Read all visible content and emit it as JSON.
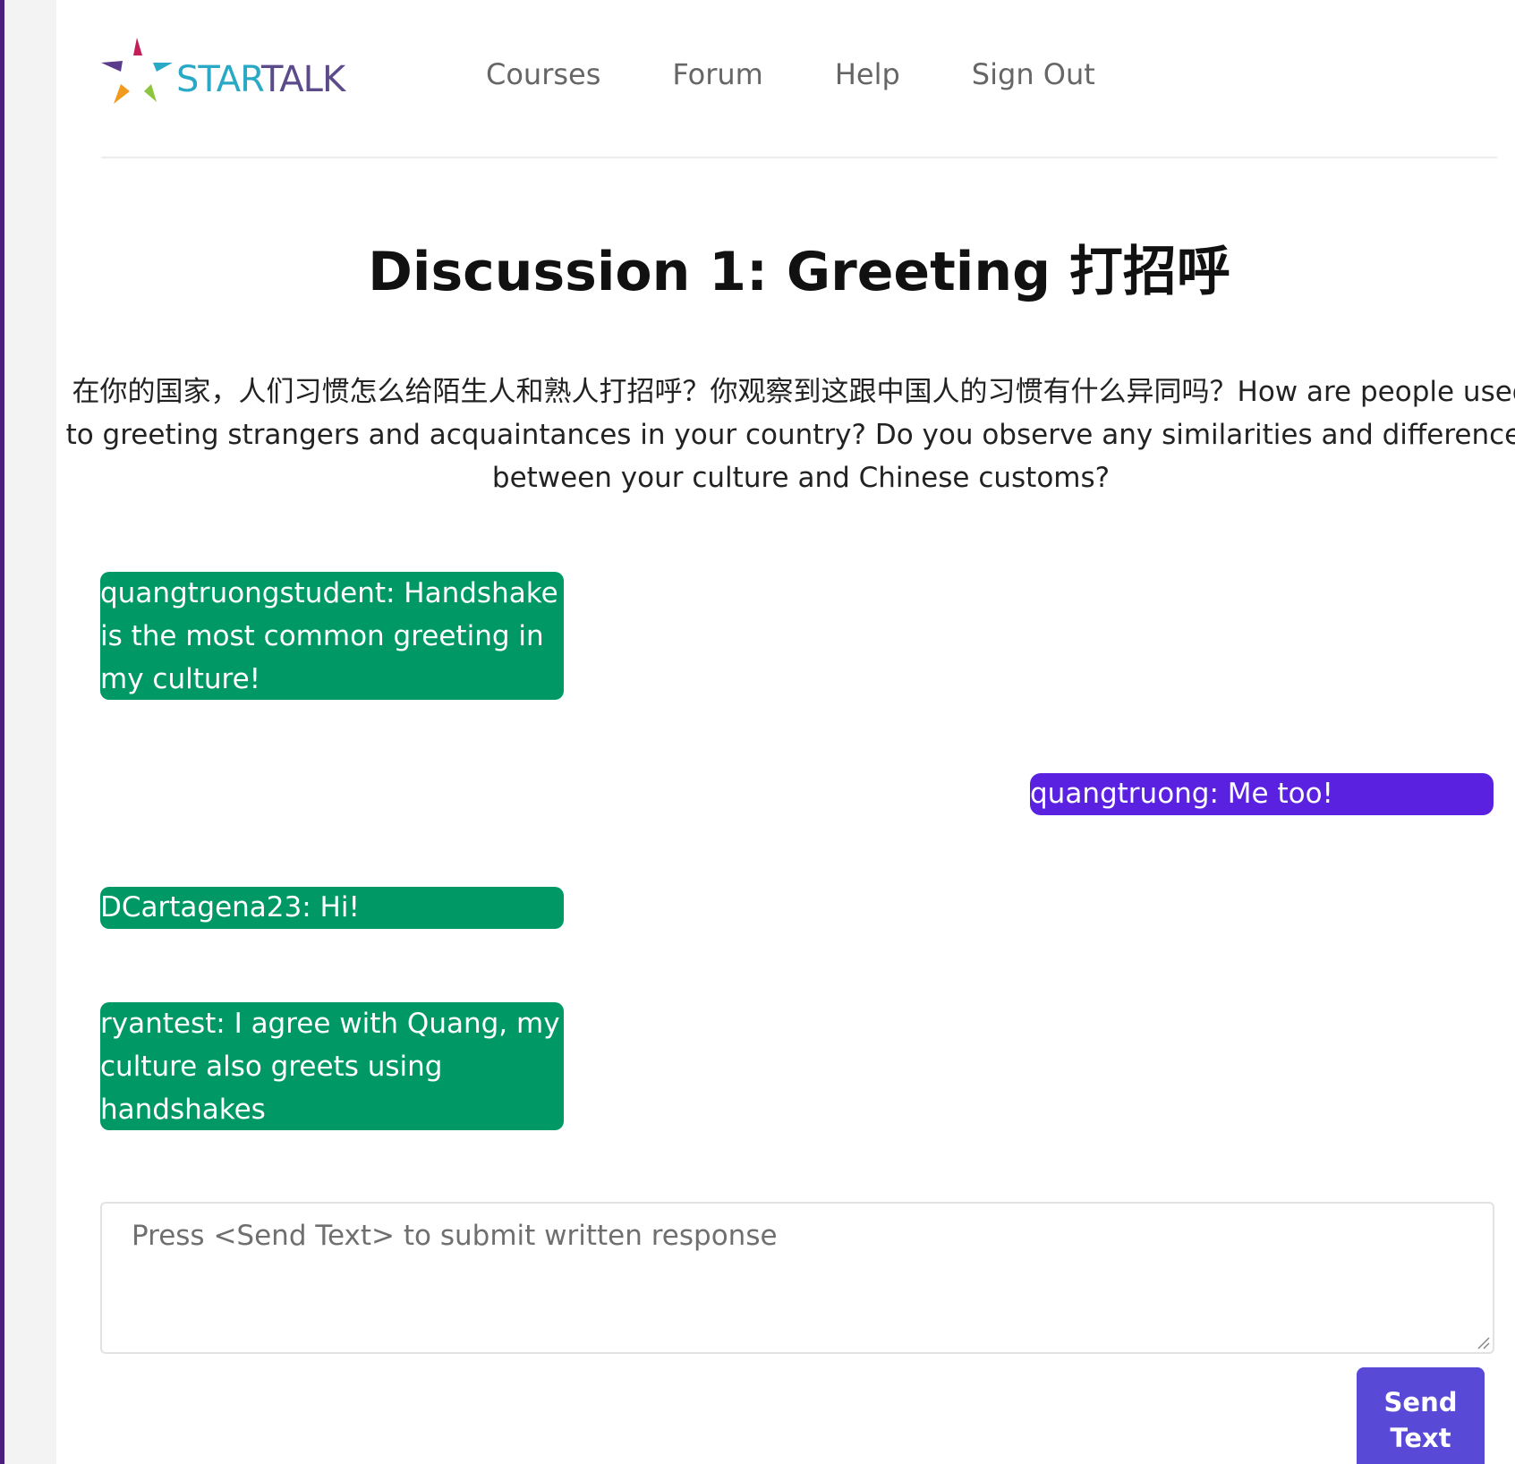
{
  "brand": {
    "logo_star": "STAR",
    "logo_talk": "TALK"
  },
  "nav": {
    "courses": "Courses",
    "forum": "Forum",
    "help": "Help",
    "sign_out": "Sign Out"
  },
  "discussion": {
    "title": "Discussion 1: Greeting 打招呼",
    "prompt": "在你的国家，人们习惯怎么给陌生人和熟人打招呼？你观察到这跟中国人的习惯有什么异同吗？How are people used to greeting strangers and acquaintances in your country? Do you observe any similarities and differences between your culture and Chinese customs?"
  },
  "messages": [
    {
      "text": "quangtruongstudent: Handshake is the most common greeting in my culture!",
      "side": "other"
    },
    {
      "text": "quangtruong: Me too!",
      "side": "self"
    },
    {
      "text": "DCartagena23: Hi!",
      "side": "other"
    },
    {
      "text": "ryantest: I agree with Quang, my culture also greets using handshakes",
      "side": "other"
    }
  ],
  "response": {
    "placeholder": "Press <Send Text> to submit written response",
    "value": ""
  },
  "send_button": {
    "label": "Send Text"
  },
  "colors": {
    "other_message": "#009966",
    "self_message": "#5b21e0",
    "send_button": "#5849d6",
    "left_edge": "#4b1f7e"
  }
}
